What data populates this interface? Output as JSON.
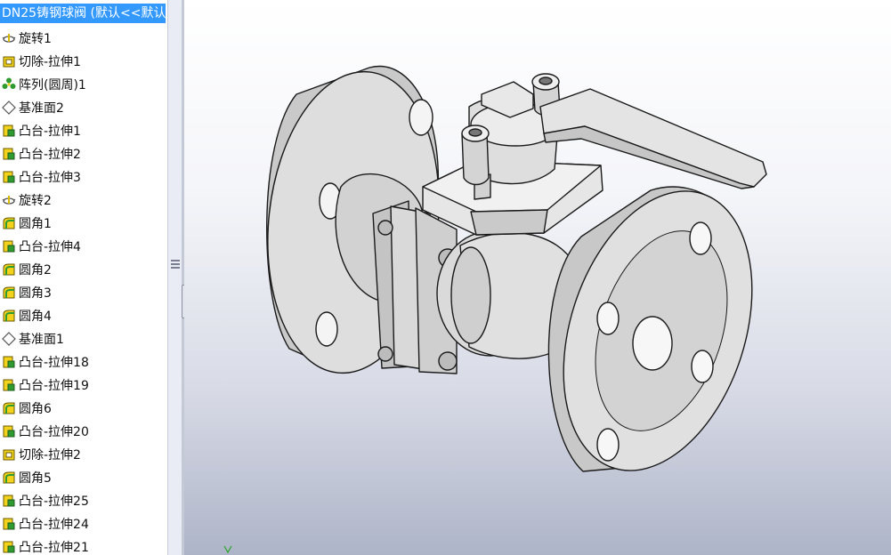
{
  "tree": {
    "title": "DN25铸钢球阀  (默认<<默认",
    "items": [
      {
        "label": "旋转1",
        "icon": "revolve-icon"
      },
      {
        "label": "切除-拉伸1",
        "icon": "cut-extrude-icon"
      },
      {
        "label": "阵列(圆周)1",
        "icon": "circular-pattern-icon"
      },
      {
        "label": "基准面2",
        "icon": "plane-icon"
      },
      {
        "label": "凸台-拉伸1",
        "icon": "boss-extrude-icon"
      },
      {
        "label": "凸台-拉伸2",
        "icon": "boss-extrude-icon"
      },
      {
        "label": "凸台-拉伸3",
        "icon": "boss-extrude-icon"
      },
      {
        "label": "旋转2",
        "icon": "revolve-icon"
      },
      {
        "label": "圆角1",
        "icon": "fillet-icon"
      },
      {
        "label": "凸台-拉伸4",
        "icon": "boss-extrude-icon"
      },
      {
        "label": "圆角2",
        "icon": "fillet-icon"
      },
      {
        "label": "圆角3",
        "icon": "fillet-icon"
      },
      {
        "label": "圆角4",
        "icon": "fillet-icon"
      },
      {
        "label": "基准面1",
        "icon": "plane-icon"
      },
      {
        "label": "凸台-拉伸18",
        "icon": "boss-extrude-icon"
      },
      {
        "label": "凸台-拉伸19",
        "icon": "boss-extrude-icon"
      },
      {
        "label": "圆角6",
        "icon": "fillet-icon"
      },
      {
        "label": "凸台-拉伸20",
        "icon": "boss-extrude-icon"
      },
      {
        "label": "切除-拉伸2",
        "icon": "cut-extrude-icon"
      },
      {
        "label": "圆角5",
        "icon": "fillet-icon"
      },
      {
        "label": "凸台-拉伸25",
        "icon": "boss-extrude-icon"
      },
      {
        "label": "凸台-拉伸24",
        "icon": "boss-extrude-icon"
      },
      {
        "label": "凸台-拉伸21",
        "icon": "boss-extrude-icon"
      }
    ]
  },
  "colors": {
    "selection": "#3399ff",
    "icon_yellow": "#f2d21a",
    "icon_green": "#2f9a2f",
    "model_face": "#d9d9d9",
    "model_edge": "#1a1a1a"
  }
}
